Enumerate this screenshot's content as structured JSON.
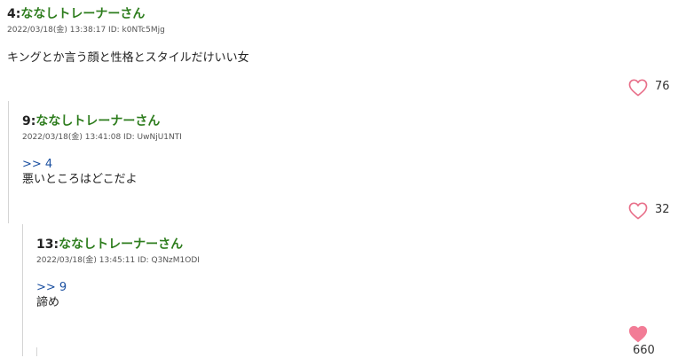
{
  "posts": [
    {
      "number": "4:",
      "name": "ななしトレーナーさん",
      "meta": "2022/03/18(金) 13:38:17 ID: k0NTc5Mjg",
      "anchor": "",
      "body": "キングとか言う顔と性格とスタイルだけいい女",
      "likes": "76",
      "liked": false
    },
    {
      "number": "9:",
      "name": "ななしトレーナーさん",
      "meta": "2022/03/18(金) 13:41:08 ID: UwNjU1NTI",
      "anchor": ">> 4",
      "body": "悪いところはどこだよ",
      "likes": "32",
      "liked": false
    },
    {
      "number": "13:",
      "name": "ななしトレーナーさん",
      "meta": "2022/03/18(金) 13:45:11 ID: Q3NzM1ODI",
      "anchor": ">> 9",
      "body": "諦め",
      "likes": "660",
      "liked": true
    }
  ],
  "colors": {
    "name": "#2e7d1e",
    "anchor": "#1a4fa0",
    "heart_outline": "#e8708a",
    "heart_filled": "#f27c96"
  },
  "icons": {
    "like": "heart-icon"
  }
}
